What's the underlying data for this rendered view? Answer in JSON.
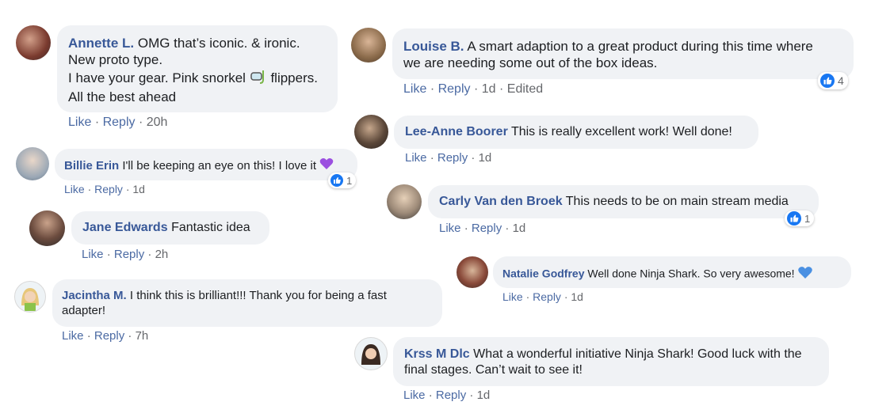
{
  "comments": [
    {
      "author": "Annette L.",
      "lines": [
        "OMG that’s iconic. & ironic.",
        "New proto type.",
        "I have your gear. Pink snorkel",
        "flippers.",
        "All the best ahead"
      ],
      "meta": {
        "like": "Like",
        "reply": "Reply",
        "time": "20h"
      }
    },
    {
      "author": "Billie Erin",
      "text": "I'll be keeping an eye on this! I love it",
      "meta": {
        "like": "Like",
        "reply": "Reply",
        "time": "1d"
      },
      "reactions": "1"
    },
    {
      "author": "Jane Edwards",
      "text": "Fantastic idea",
      "meta": {
        "like": "Like",
        "reply": "Reply",
        "time": "2h"
      }
    },
    {
      "author": "Jacintha M.",
      "lines": [
        "I think this is brilliant!!! Thank you for being a fast",
        "adapter!"
      ],
      "meta": {
        "like": "Like",
        "reply": "Reply",
        "time": "7h"
      }
    },
    {
      "author": "Louise B.",
      "lines": [
        "A smart adaption to a great product during this time where",
        "we are needing some out of the box ideas."
      ],
      "meta": {
        "like": "Like",
        "reply": "Reply",
        "time": "1d",
        "edited": "Edited"
      },
      "reactions": "4"
    },
    {
      "author": "Lee-Anne Boorer",
      "text": "This is really excellent work! Well done!",
      "meta": {
        "like": "Like",
        "reply": "Reply",
        "time": "1d"
      }
    },
    {
      "author": "Carly Van den Broek",
      "text": "This needs to be on main stream media",
      "meta": {
        "like": "Like",
        "reply": "Reply",
        "time": "1d"
      },
      "reactions": "1"
    },
    {
      "author": "Natalie Godfrey",
      "text": "Well done Ninja Shark. So very awesome!",
      "meta": {
        "like": "Like",
        "reply": "Reply",
        "time": "1d"
      }
    },
    {
      "author": "Krss M Dlc",
      "lines": [
        "What a wonderful initiative Ninja Shark! Good luck with the",
        "final stages. Can’t wait to see it!"
      ],
      "meta": {
        "like": "Like",
        "reply": "Reply",
        "time": "1d"
      }
    }
  ],
  "separator": "·",
  "colors": {
    "bubble": "#f0f2f5",
    "author": "#385898",
    "link": "#4b6aa3",
    "like_blue": "#1877f2",
    "heart_purple": "#9b4fe0",
    "heart_blue": "#4a90e2"
  },
  "icons": [
    "snorkel-icon",
    "purple-heart-icon",
    "blue-heart-icon",
    "like-reaction-icon"
  ]
}
